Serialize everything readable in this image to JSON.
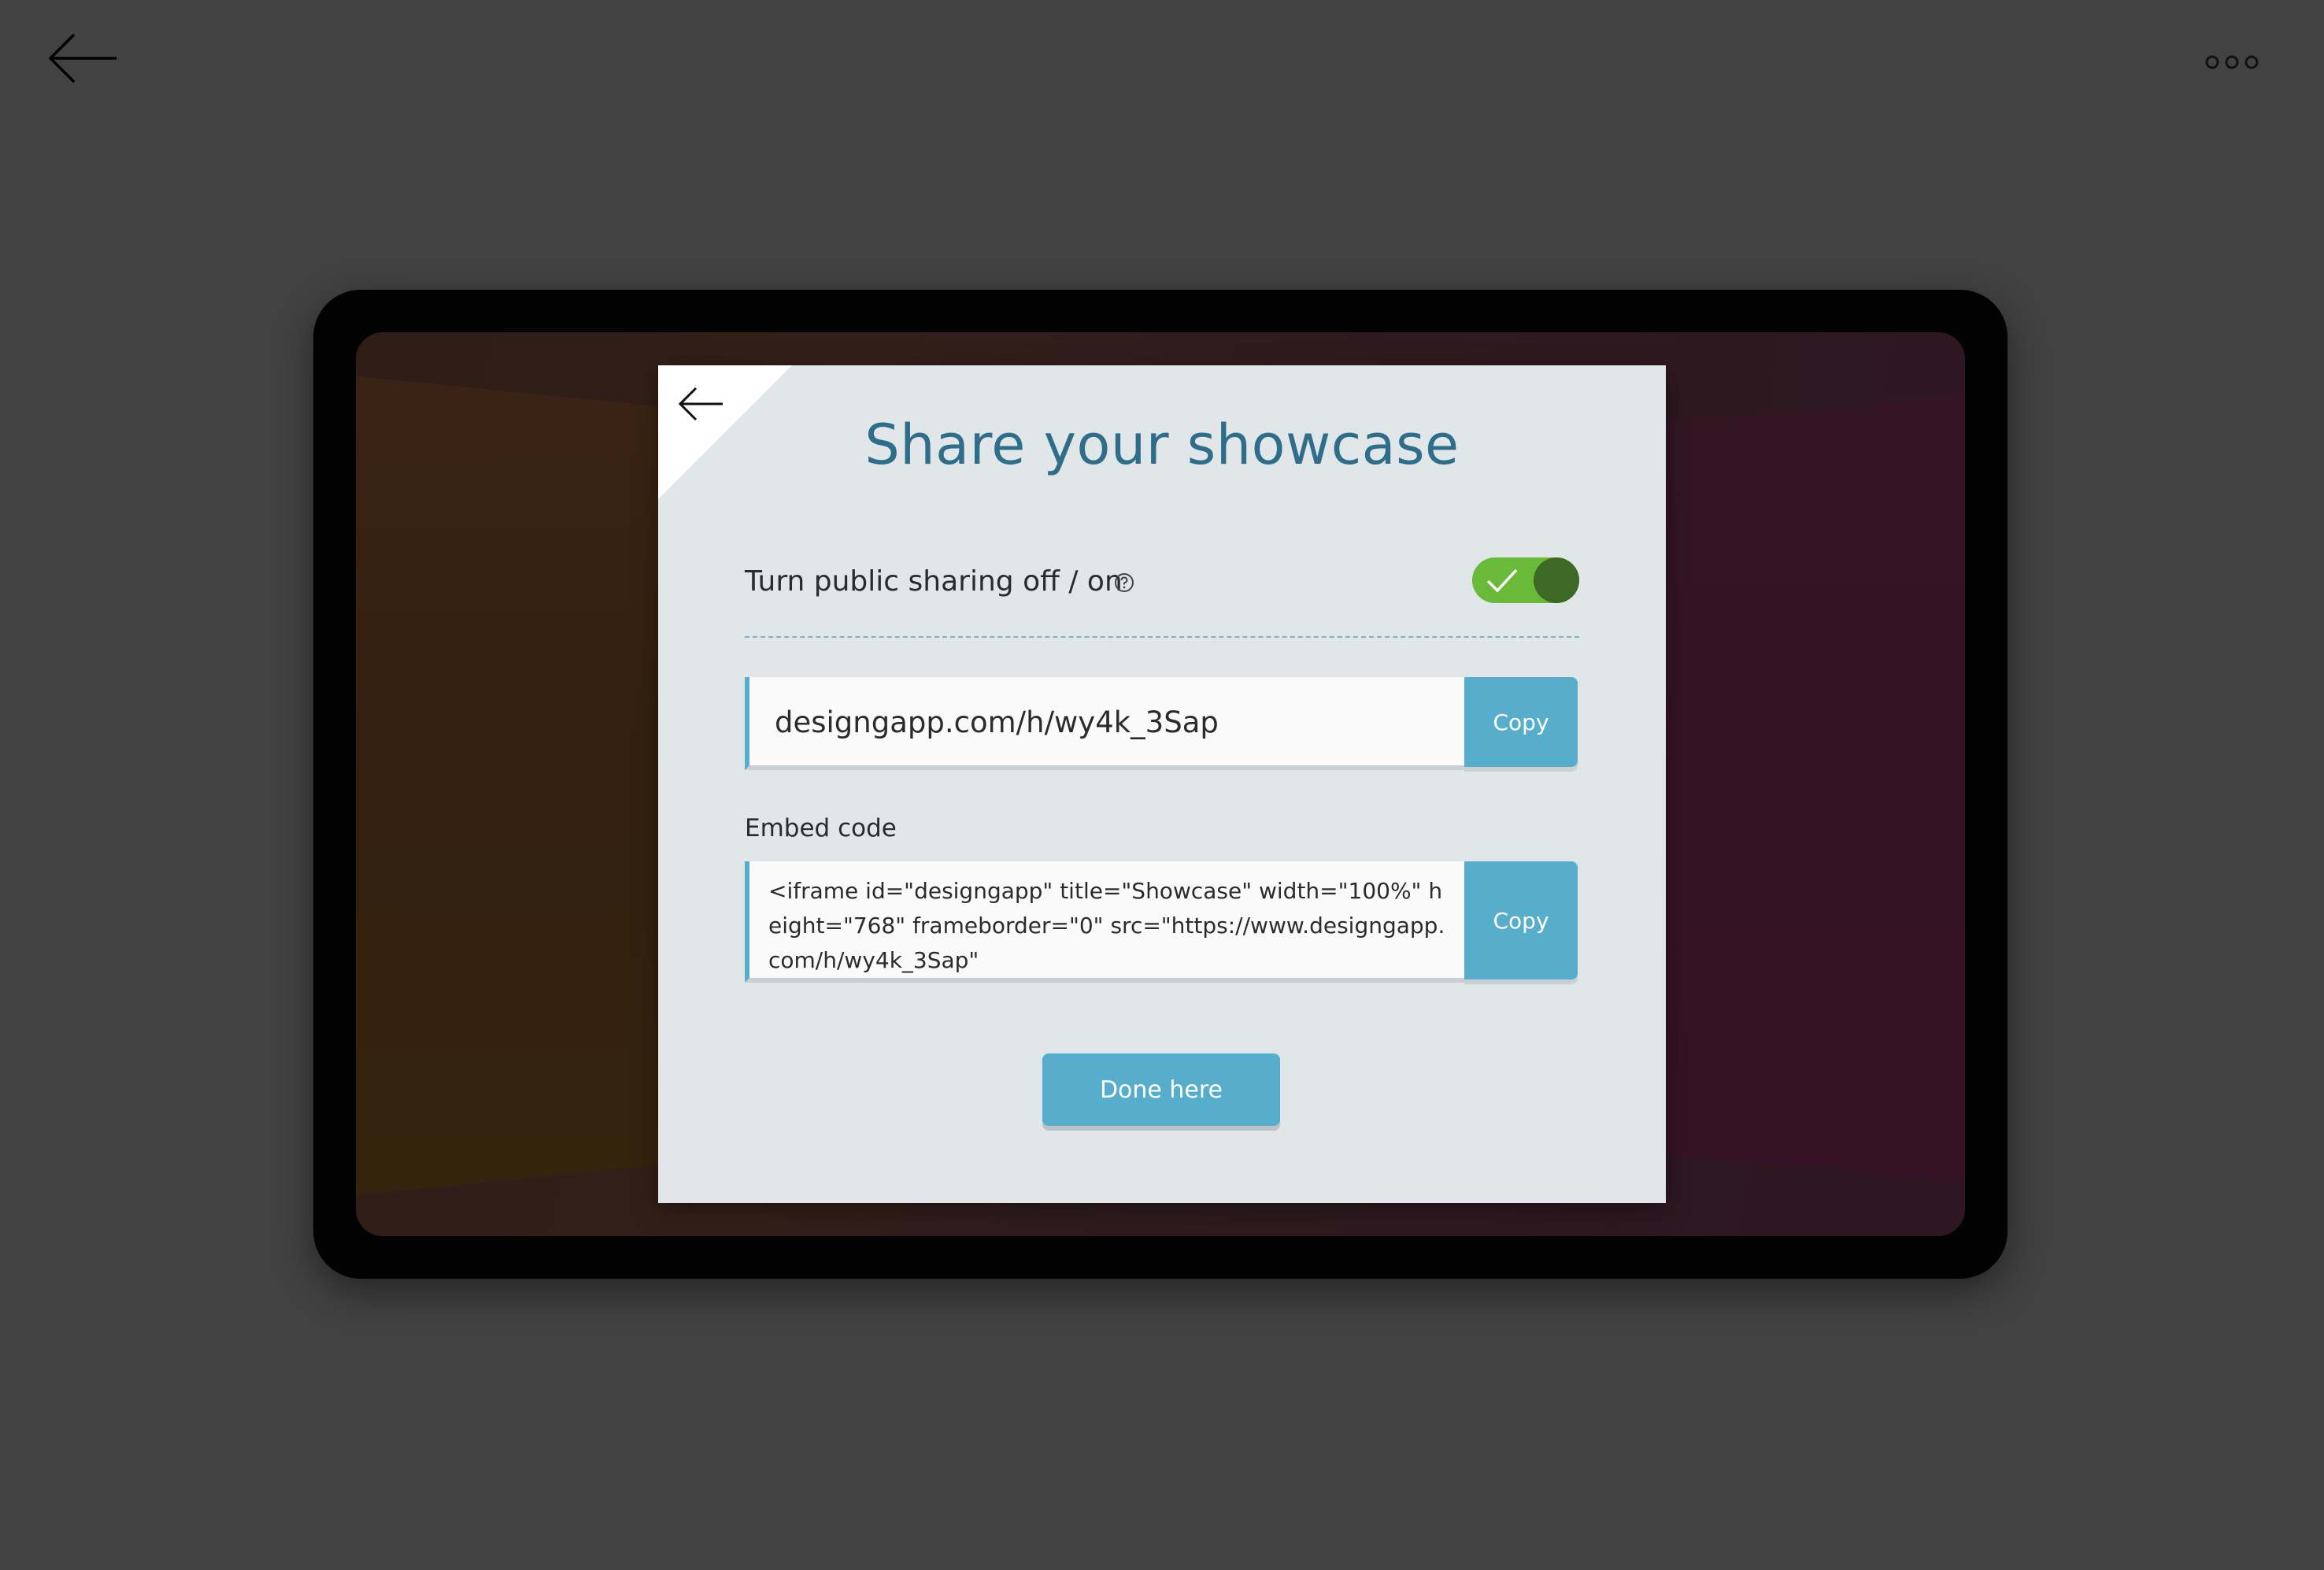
{
  "page": {
    "back_icon": "arrow-left-icon",
    "menu_icon": "more-horizontal-icon"
  },
  "dialog": {
    "title": "Share your showcase",
    "back_icon": "arrow-left-icon",
    "sharing": {
      "label": "Turn public sharing off / on",
      "help_icon": "question-circle-icon",
      "toggle_on": true,
      "toggle_icon": "check-icon"
    },
    "url": {
      "value": "designgapp.com/h/wy4k_3Sap",
      "copy_label": "Copy"
    },
    "embed": {
      "label": "Embed code",
      "value": "<iframe id=\"designgapp\" title=\"Showcase\" width=\"100%\" height=\"768\" frameborder=\"0\" src=\"https://www.designgapp.com/h/wy4k_3Sap\"",
      "copy_label": "Copy"
    },
    "done_label": "Done here"
  },
  "colors": {
    "page_bg": "#424242",
    "accent": "#56adcc",
    "title": "#2e6e8a",
    "toggle_on": "#6aba3a",
    "toggle_knob": "#3c6a26",
    "dialog_bg": "#e1e6e9"
  }
}
